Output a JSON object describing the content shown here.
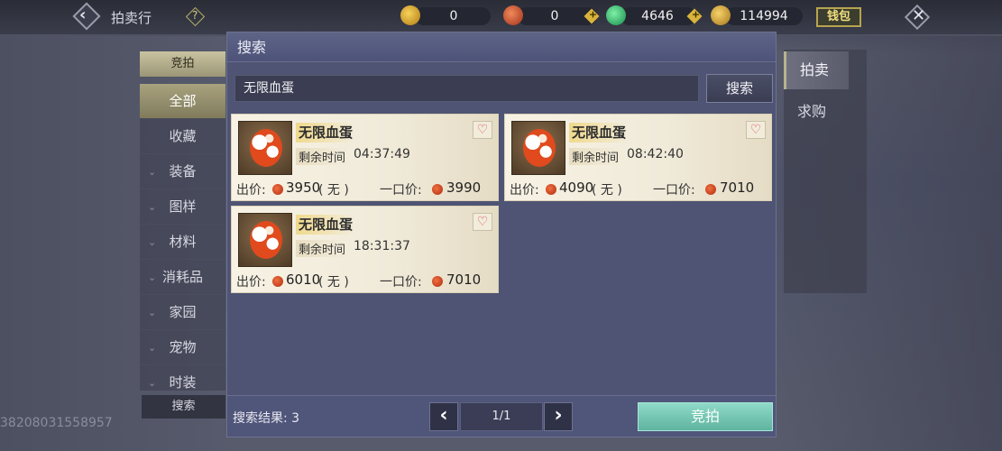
{
  "header": {
    "title": "拍卖行",
    "help": "?",
    "currencies": [
      {
        "icon": "gold-fan-icon",
        "value": "0"
      },
      {
        "icon": "red-coin-icon",
        "value": "0"
      },
      {
        "icon": "jade-icon",
        "value": "4646"
      },
      {
        "icon": "gold-ingot-icon",
        "value": "114994"
      }
    ],
    "wallet_label": "钱包"
  },
  "sidebar": {
    "header": "竞拍",
    "items": [
      {
        "label": "全部",
        "active": true
      },
      {
        "label": "收藏"
      },
      {
        "label": "装备",
        "expandable": true
      },
      {
        "label": "图样",
        "expandable": true
      },
      {
        "label": "材料",
        "expandable": true
      },
      {
        "label": "消耗品",
        "expandable": true
      },
      {
        "label": "家园",
        "expandable": true
      },
      {
        "label": "宠物",
        "expandable": true
      },
      {
        "label": "时装",
        "expandable": true
      }
    ],
    "search_label": "搜索"
  },
  "footer_id": "3820803155895​7",
  "dialog": {
    "title": "搜索",
    "search_value": "无限血蛋",
    "search_button": "搜索",
    "results": [
      {
        "name": "无限血蛋",
        "time_label": "剩余时间",
        "time": "04:37:49",
        "bid_label": "出价:",
        "bid": "3950",
        "bid_note": "( 无 )",
        "buyout_label": "一口价:",
        "buyout": "3990"
      },
      {
        "name": "无限血蛋",
        "time_label": "剩余时间",
        "time": "08:42:40",
        "bid_label": "出价:",
        "bid": "4090",
        "bid_note": "( 无 )",
        "buyout_label": "一口价:",
        "buyout": "7010"
      },
      {
        "name": "无限血蛋",
        "time_label": "剩余时间",
        "time": "18:31:37",
        "bid_label": "出价:",
        "bid": "6010",
        "bid_note": "( 无 )",
        "buyout_label": "一口价:",
        "buyout": "7010"
      }
    ],
    "result_count_label": "搜索结果: 3",
    "page_indicator": "1/1",
    "bid_button": "竞拍"
  },
  "right_tabs": [
    {
      "label": "拍卖",
      "active": true
    },
    {
      "label": "求购"
    }
  ]
}
